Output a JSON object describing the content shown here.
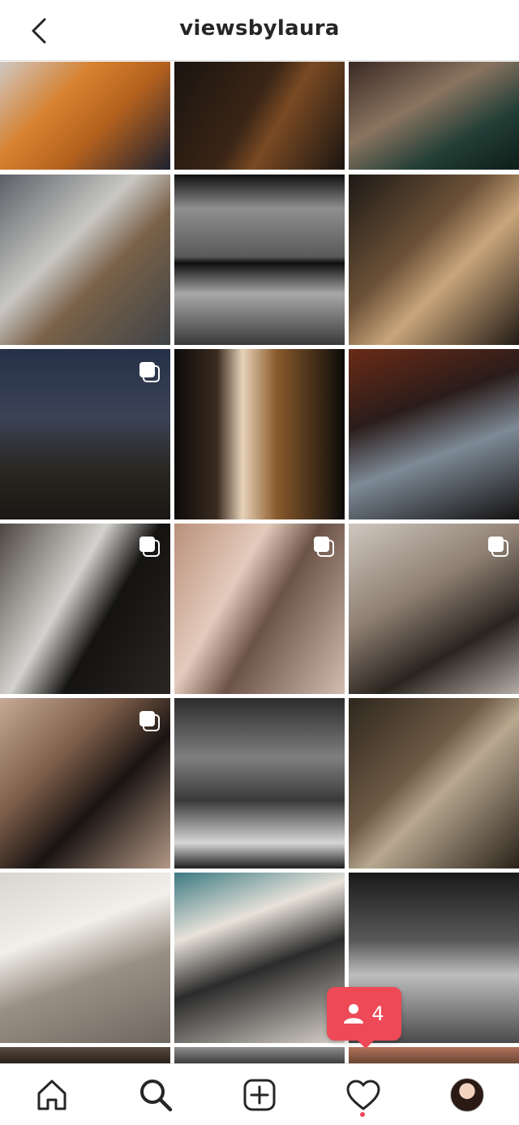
{
  "header": {
    "title": "viewsbylaura",
    "back_icon": "chevron-left-icon"
  },
  "grid": {
    "tiles": [
      {
        "name": "post-copper-hair",
        "bg": "linear-gradient(135deg,#cfc8c2 0%,#d6802e 35%,#b5621e 60%,#1c2030 100%)",
        "multi": false
      },
      {
        "name": "post-dark-portrait-hair",
        "bg": "linear-gradient(120deg,#1a140f 0%,#3a2516 45%,#7a4a23 60%,#1b1511 100%)",
        "multi": false
      },
      {
        "name": "post-green-blazer",
        "bg": "linear-gradient(150deg,#3a2a24 0%,#8a7460 40%,#223e36 70%,#0f1d19 100%)",
        "multi": false
      },
      {
        "name": "post-studio-plaid",
        "bg": "linear-gradient(135deg,#5b5f66 0%,#c9c8c4 40%,#7a6248 60%,#3f4348 100%)",
        "multi": false
      },
      {
        "name": "post-bw-rooftop-film",
        "bg": "linear-gradient(180deg,#111 0%,#8f8f8f 20%,#5a5a5a 48%,#0e0e0e 52%,#a8a8a8 70%,#3a3a3a 100%)",
        "multi": false
      },
      {
        "name": "post-sunglasses-closeup",
        "bg": "linear-gradient(135deg,#1d1915 0%,#6b5137 40%,#c9a57a 60%,#221b15 100%)",
        "multi": false
      },
      {
        "name": "post-night-skyline",
        "bg": "linear-gradient(180deg,#253048 0%,#3b4356 40%,#2a2722 70%,#1a1714 100%)",
        "multi": true
      },
      {
        "name": "post-mirror-lights",
        "bg": "linear-gradient(90deg,#0d0b09 0%,#3a2b20 25%,#e7d3b8 40%,#8a5a2c 60%,#0b0a09 100%)",
        "multi": false
      },
      {
        "name": "post-neon-blazer",
        "bg": "linear-gradient(160deg,#6a2a16 0%,#2a1c1a 35%,#7d8a96 60%,#141212 100%)",
        "multi": false
      },
      {
        "name": "post-grey-blazer-wall",
        "bg": "linear-gradient(120deg,#4c4641 0%,#d4d2ce 40%,#141312 60%,#2a2624 100%)",
        "multi": true
      },
      {
        "name": "post-perfume-mirror",
        "bg": "linear-gradient(120deg,#b9907a 0%,#e4cbbd 35%,#6c5347 55%,#d2bdb0 100%)",
        "multi": true
      },
      {
        "name": "post-seated-shadow",
        "bg": "linear-gradient(150deg,#cfc7bf 0%,#8e7f72 40%,#2a241f 70%,#b4aca6 100%)",
        "multi": true
      },
      {
        "name": "post-sunglasses-blazer",
        "bg": "linear-gradient(135deg,#c6aa96 0%,#7c5d49 35%,#1a1412 60%,#b39885 100%)",
        "multi": true
      },
      {
        "name": "post-bw-water",
        "bg": "linear-gradient(180deg,#2c2c2c 0%,#7f7f7f 35%,#3a3a3a 60%,#d6d6d6 85%,#1d1d1d 100%)",
        "multi": false
      },
      {
        "name": "post-window-chair",
        "bg": "linear-gradient(135deg,#2e261d 0%,#6d5a45 40%,#b8a890 55%,#2a2219 100%)",
        "multi": false
      },
      {
        "name": "post-sofa-white-shirt",
        "bg": "linear-gradient(160deg,#d9d5ce 0%,#f1efea 35%,#9a8f84 60%,#6f6861 100%)",
        "multi": false
      },
      {
        "name": "post-patterned-sofa",
        "bg": "linear-gradient(160deg,#3c7a82 0%,#e8e2da 30%,#2b2b2b 55%,#d8d2ca 100%)",
        "multi": false
      },
      {
        "name": "post-bw-beach-rocks",
        "bg": "linear-gradient(180deg,#1a1a1a 0%,#595959 40%,#bdbdbd 60%,#4a4a4a 100%)",
        "multi": false
      },
      {
        "name": "post-partial-1",
        "bg": "linear-gradient(180deg,#5a4a3e,#2a211b)",
        "multi": false
      },
      {
        "name": "post-partial-2",
        "bg": "linear-gradient(180deg,#8f8f8f,#3d3d3d)",
        "multi": false
      },
      {
        "name": "post-partial-3",
        "bg": "linear-gradient(180deg,#b0735b,#6b4433)",
        "multi": false
      }
    ]
  },
  "activity": {
    "icon": "person-icon",
    "count": "4",
    "color": "#ed4956"
  },
  "nav": {
    "items": [
      {
        "name": "nav-home",
        "icon": "home-icon"
      },
      {
        "name": "nav-search",
        "icon": "search-icon"
      },
      {
        "name": "nav-new-post",
        "icon": "plus-square-icon"
      },
      {
        "name": "nav-activity",
        "icon": "heart-icon"
      },
      {
        "name": "nav-profile",
        "icon": "profile-avatar"
      }
    ]
  }
}
